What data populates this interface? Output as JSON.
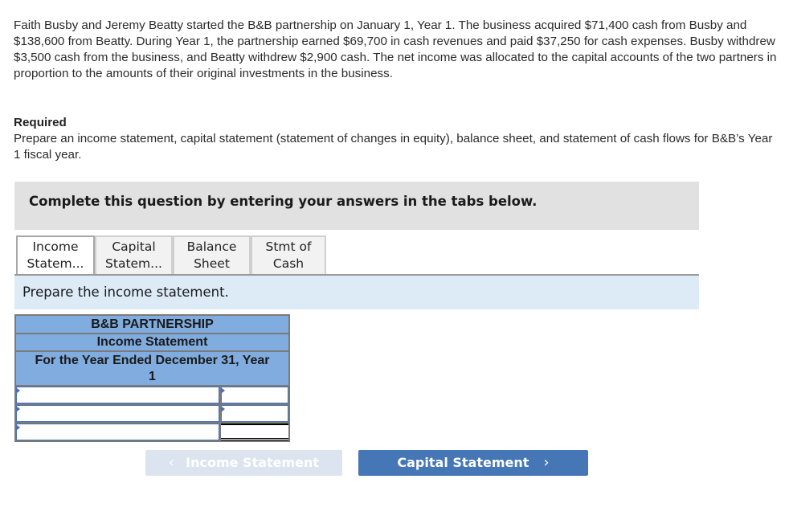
{
  "problem": {
    "text": "Faith Busby and Jeremy Beatty started the B&B partnership on January 1, Year 1. The business acquired $71,400 cash from Busby and $138,600 from Beatty. During Year 1, the partnership earned $69,700 in cash revenues and paid $37,250 for cash expenses. Busby withdrew $3,500 cash from the business, and Beatty withdrew $2,900 cash. The net income was allocated to the capital accounts of the two partners in proportion to the amounts of their original investments in the business."
  },
  "required": {
    "title": "Required",
    "text": "Prepare an income statement, capital statement (statement of changes in equity), balance sheet, and statement of cash flows for B&B’s Year 1 fiscal year."
  },
  "instruction": "Complete this question by entering your answers in the tabs below.",
  "tabs": [
    {
      "line1": "Income",
      "line2": "Statem...",
      "active": true
    },
    {
      "line1": "Capital",
      "line2": "Statem...",
      "active": false
    },
    {
      "line1": "Balance",
      "line2": "Sheet",
      "active": false
    },
    {
      "line1": "Stmt of",
      "line2": "Cash",
      "active": false
    }
  ],
  "prompt": "Prepare the income statement.",
  "statement": {
    "company": "B&B PARTNERSHIP",
    "title": "Income Statement",
    "period_line1": "For the Year Ended December 31, Year",
    "period_line2": "1",
    "rows": [
      {
        "label": "",
        "amount": ""
      },
      {
        "label": "",
        "amount": ""
      },
      {
        "label": "",
        "amount": ""
      }
    ]
  },
  "navigation": {
    "prev_label": "Income Statement",
    "next_label": "Capital Statement",
    "prev_icon": "chevron-left-icon",
    "next_icon": "chevron-right-icon"
  },
  "colors": {
    "header_blue": "#80acdf",
    "prompt_bg": "#ddebf7",
    "next_button": "#4576b5",
    "prev_button_disabled": "#dce4ef",
    "instruction_bg": "#e1e1e1"
  }
}
